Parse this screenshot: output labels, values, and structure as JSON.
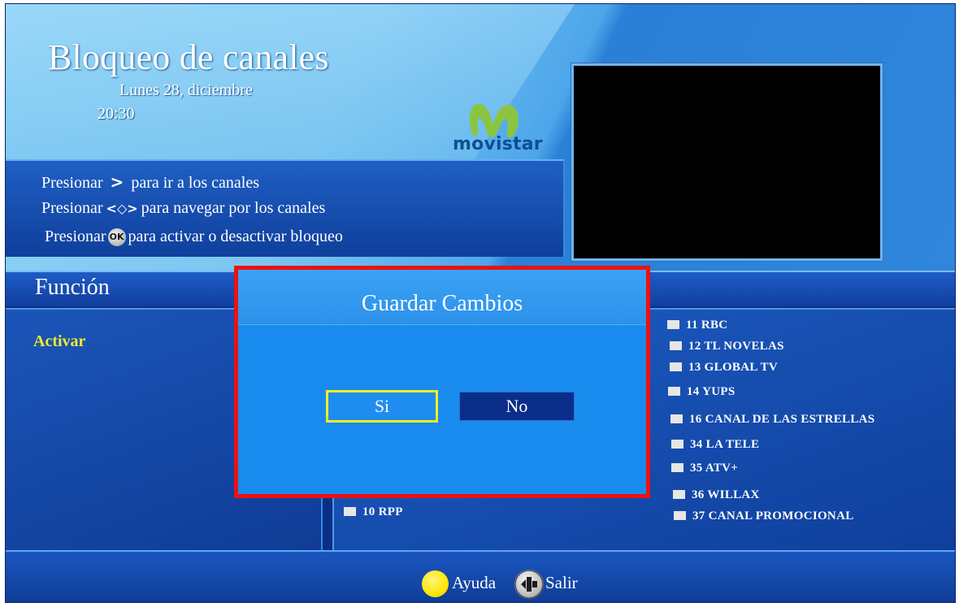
{
  "header": {
    "title": "Bloqueo de canales",
    "date": "Lunes 28, diciembre",
    "time": "20:30",
    "brand": "movistar"
  },
  "instructions": [
    {
      "prefix": "Presionar",
      "symbol": ">",
      "text": "para ir a los canales"
    },
    {
      "prefix": "Presionar",
      "symbol": "<◇>",
      "text": "para navegar por los canales"
    },
    {
      "prefix": "Presionar",
      "symbol": "OK",
      "text": "para activar o desactivar bloqueo"
    }
  ],
  "function_bar": {
    "label": "Función"
  },
  "left_panel": {
    "selected_item": "Activar"
  },
  "channels_right": [
    "11 RBC",
    "12 TL NOVELAS",
    "13 GLOBAL TV",
    "14 YUPS",
    "16 CANAL DE LAS ESTRELLAS",
    "34 LA TELE",
    "35  ATV+",
    "36 WILLAX",
    "37 CANAL PROMOCIONAL"
  ],
  "channels_left": [
    "10 RPP"
  ],
  "dialog": {
    "title": "Guardar Cambios",
    "yes_label": "Si",
    "no_label": "No",
    "highlight_color": "#ee1010",
    "focus_color": "#f4ef1f"
  },
  "footer": {
    "help_label": "Ayuda",
    "exit_label": "Salir",
    "help_icon": "yellow-dot-icon",
    "exit_icon": "exit-icon"
  }
}
